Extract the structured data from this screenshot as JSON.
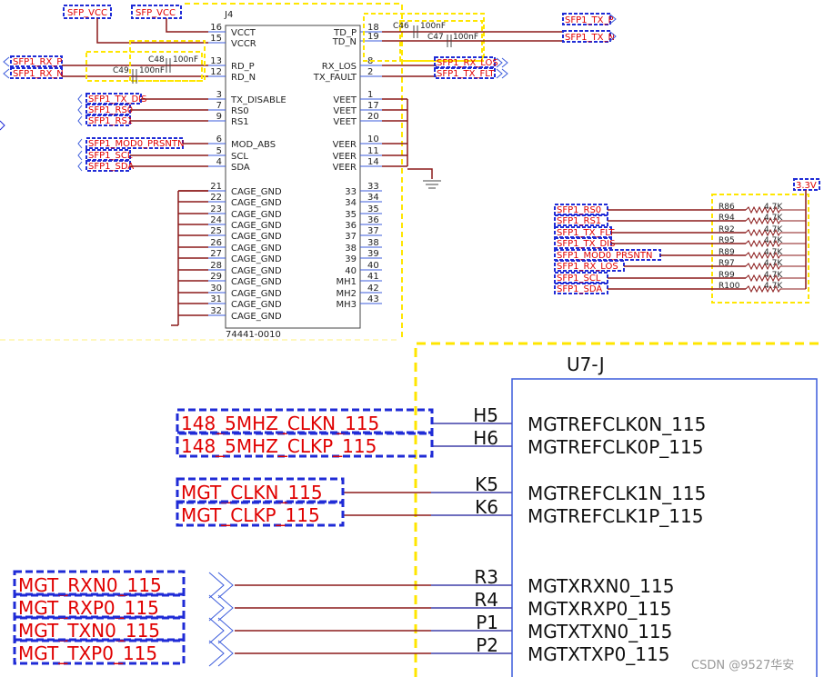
{
  "top_ports": [
    {
      "label": "SFP_VCC"
    },
    {
      "label": "SFP_VCC"
    }
  ],
  "j4": {
    "ref": "J4",
    "part": "74441-0010",
    "left_pins": [
      {
        "num": "16",
        "name": "VCCT"
      },
      {
        "num": "15",
        "name": "VCCR"
      },
      {
        "num": "13",
        "name": "RD_P"
      },
      {
        "num": "12",
        "name": "RD_N"
      },
      {
        "num": "3",
        "name": "TX_DISABLE"
      },
      {
        "num": "7",
        "name": "RS0"
      },
      {
        "num": "9",
        "name": "RS1"
      },
      {
        "num": "6",
        "name": "MOD_ABS"
      },
      {
        "num": "5",
        "name": "SCL"
      },
      {
        "num": "4",
        "name": "SDA"
      },
      {
        "num": "21",
        "name": "CAGE_GND"
      },
      {
        "num": "22",
        "name": "CAGE_GND"
      },
      {
        "num": "23",
        "name": "CAGE_GND"
      },
      {
        "num": "24",
        "name": "CAGE_GND"
      },
      {
        "num": "25",
        "name": "CAGE_GND"
      },
      {
        "num": "26",
        "name": "CAGE_GND"
      },
      {
        "num": "27",
        "name": "CAGE_GND"
      },
      {
        "num": "28",
        "name": "CAGE_GND"
      },
      {
        "num": "29",
        "name": "CAGE_GND"
      },
      {
        "num": "30",
        "name": "CAGE_GND"
      },
      {
        "num": "31",
        "name": "CAGE_GND"
      },
      {
        "num": "32",
        "name": "CAGE_GND"
      }
    ],
    "right_pins": [
      {
        "num": "18",
        "name": "TD_P"
      },
      {
        "num": "19",
        "name": "TD_N"
      },
      {
        "num": "8",
        "name": "RX_LOS"
      },
      {
        "num": "2",
        "name": "TX_FAULT"
      },
      {
        "num": "1",
        "name": "VEET"
      },
      {
        "num": "17",
        "name": "VEET"
      },
      {
        "num": "20",
        "name": "VEET"
      },
      {
        "num": "10",
        "name": "VEER"
      },
      {
        "num": "11",
        "name": "VEER"
      },
      {
        "num": "14",
        "name": "VEER"
      },
      {
        "num": "33",
        "name": "33"
      },
      {
        "num": "34",
        "name": "34"
      },
      {
        "num": "35",
        "name": "35"
      },
      {
        "num": "36",
        "name": "36"
      },
      {
        "num": "37",
        "name": "37"
      },
      {
        "num": "38",
        "name": "38"
      },
      {
        "num": "39",
        "name": "39"
      },
      {
        "num": "40",
        "name": "40"
      },
      {
        "num": "41",
        "name": "MH1"
      },
      {
        "num": "42",
        "name": "MH2"
      },
      {
        "num": "43",
        "name": "MH3"
      }
    ]
  },
  "caps": [
    {
      "ref": "C48",
      "value": "100nF"
    },
    {
      "ref": "C49",
      "value": "100nF"
    },
    {
      "ref": "C46",
      "value": "100nF"
    },
    {
      "ref": "C47",
      "value": "100nF"
    }
  ],
  "j4_left_ports": [
    {
      "label": "SFP1_RX_P"
    },
    {
      "label": "SFP1_RX_N"
    },
    {
      "label": "SFP1_TX_DIS"
    },
    {
      "label": "SFP1_RS0"
    },
    {
      "label": "SFP1_RS1"
    },
    {
      "label": "SFP1_MOD0_PRSNTN"
    },
    {
      "label": "SFP1_SCL"
    },
    {
      "label": "SFP1_SDA"
    }
  ],
  "j4_right_ports": [
    {
      "label": "SFP1_TX_P"
    },
    {
      "label": "SFP1_TX_N"
    },
    {
      "label": "SFP1_RX_LOS"
    },
    {
      "label": "SFP1_TX_FLT"
    }
  ],
  "power_port": {
    "label": "3.3V"
  },
  "pullups": [
    {
      "net": "SFP1_RS0",
      "ref": "R86",
      "value": "4.7K"
    },
    {
      "net": "SFP1_RS1",
      "ref": "R94",
      "value": "4.7K"
    },
    {
      "net": "SFP1_TX_FLT",
      "ref": "R92",
      "value": "4.7K"
    },
    {
      "net": "SFP1_TX_DIS",
      "ref": "R95",
      "value": "4.7K"
    },
    {
      "net": "SFP1_MOD0_PRSNTN",
      "ref": "R89",
      "value": "4.7K"
    },
    {
      "net": "SFP1_RX_LOS",
      "ref": "R97",
      "value": "4.7K"
    },
    {
      "net": "SFP1_SCL",
      "ref": "R99",
      "value": "4.7K"
    },
    {
      "net": "SFP1_SDA",
      "ref": "R100",
      "value": "4.7K"
    }
  ],
  "u7": {
    "ref": "U7-J",
    "pins": [
      {
        "net": "148_5MHZ_CLKN_115",
        "num": "H5",
        "name": "MGTREFCLK0N_115"
      },
      {
        "net": "148_5MHZ_CLKP_115",
        "num": "H6",
        "name": "MGTREFCLK0P_115"
      },
      {
        "net": "MGT_CLKN_115",
        "num": "K5",
        "name": "MGTREFCLK1N_115"
      },
      {
        "net": "MGT_CLKP_115",
        "num": "K6",
        "name": "MGTREFCLK1P_115"
      },
      {
        "net": "MGT_RXN0_115",
        "num": "R3",
        "name": "MGTXRXN0_115"
      },
      {
        "net": "MGT_RXP0_115",
        "num": "R4",
        "name": "MGTXRXP0_115"
      },
      {
        "net": "MGT_TXN0_115",
        "num": "P1",
        "name": "MGTXTXN0_115"
      },
      {
        "net": "MGT_TXP0_115",
        "num": "P2",
        "name": "MGTXTXP0_115"
      }
    ]
  },
  "watermark": "CSDN @9527华安",
  "colors": {
    "wire": "#8b1a1a",
    "pin": "#3b5bdb",
    "net_text": "#e00000",
    "port_border": "#1f2bd6",
    "yellow": "#ffe600"
  }
}
